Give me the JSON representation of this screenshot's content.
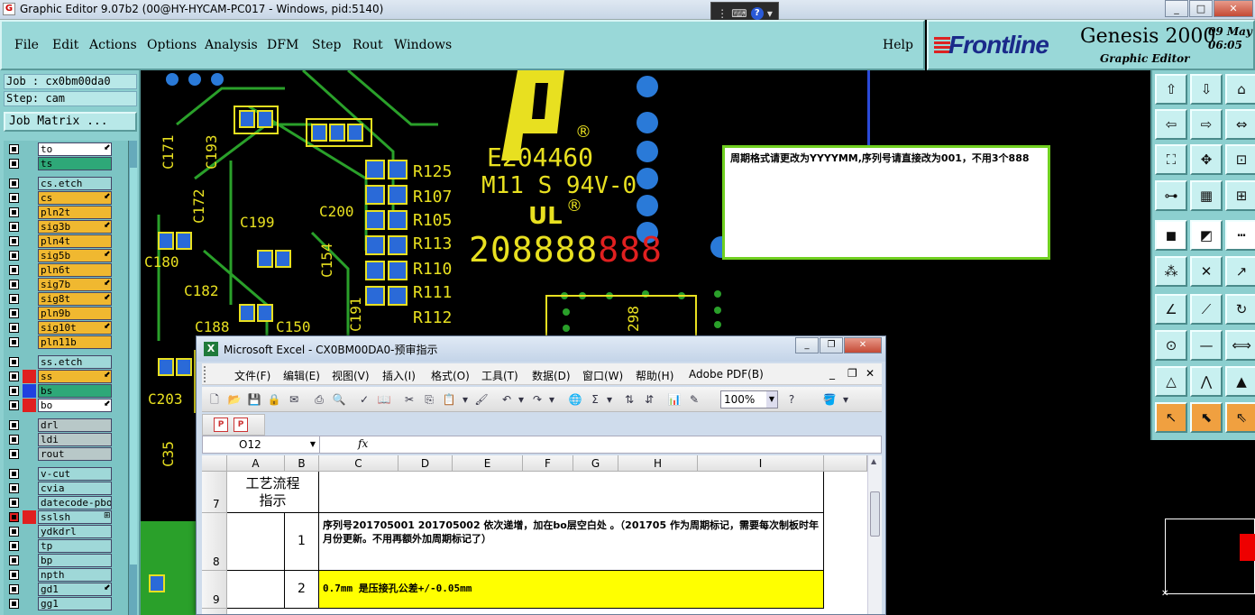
{
  "window": {
    "title": "Graphic Editor 9.07b2 (00@HY-HYCAM-PC017 - Windows, pid:5140)"
  },
  "menu": [
    "File",
    "Edit",
    "Actions",
    "Options",
    "Analysis",
    "DFM",
    "Step",
    "Rout",
    "Windows"
  ],
  "help": "Help",
  "brand": {
    "logo": "Frontline",
    "product": "Genesis 2000",
    "subtitle": "Graphic Editor",
    "date_line1": "09 May",
    "date_line2": "06:05"
  },
  "job": {
    "job_label": "Job : cx0bm00da0",
    "step_label": "Step: cam",
    "matrix_button": "Job Matrix ..."
  },
  "layers": [
    {
      "name": "to",
      "color": "#ffffff",
      "flag": "⬋"
    },
    {
      "name": "ts",
      "color": "#2ea878",
      "flag": ""
    },
    {
      "name": "cs.etch",
      "color": "#9fd8d8",
      "flag": ""
    },
    {
      "name": "cs",
      "color": "#f0b830",
      "flag": "⬋"
    },
    {
      "name": "pln2t",
      "color": "#f0b830",
      "flag": ""
    },
    {
      "name": "sig3b",
      "color": "#f0b830",
      "flag": "⬋"
    },
    {
      "name": "pln4t",
      "color": "#f0b830",
      "flag": ""
    },
    {
      "name": "sig5b",
      "color": "#f0b830",
      "flag": "⬋"
    },
    {
      "name": "pln6t",
      "color": "#f0b830",
      "flag": ""
    },
    {
      "name": "sig7b",
      "color": "#f0b830",
      "flag": "⬋"
    },
    {
      "name": "sig8t",
      "color": "#f0b830",
      "flag": "⬋"
    },
    {
      "name": "pln9b",
      "color": "#f0b830",
      "flag": ""
    },
    {
      "name": "sig10t",
      "color": "#f0b830",
      "flag": "⬋"
    },
    {
      "name": "pln11b",
      "color": "#f0b830",
      "flag": ""
    },
    {
      "name": "ss.etch",
      "color": "#9fd8d8",
      "flag": ""
    },
    {
      "name": "ss",
      "color": "#f0b830",
      "flag": "⬋"
    },
    {
      "name": "bs",
      "color": "#2ea878",
      "flag": ""
    },
    {
      "name": "bo",
      "color": "#ffffff",
      "flag": "⬋"
    },
    {
      "name": "drl",
      "color": "#b8c8c8",
      "flag": ""
    },
    {
      "name": "ldi",
      "color": "#b8c8c8",
      "flag": ""
    },
    {
      "name": "rout",
      "color": "#b8c8c8",
      "flag": ""
    },
    {
      "name": "v-cut",
      "color": "#9fd8d8",
      "flag": ""
    },
    {
      "name": "cvia",
      "color": "#9fd8d8",
      "flag": ""
    },
    {
      "name": "datecode-pbo",
      "color": "#9fd8d8",
      "flag": ""
    },
    {
      "name": "sslsh",
      "color": "#9fd8d8",
      "flag": "⊞"
    },
    {
      "name": "ydkdrl",
      "color": "#9fd8d8",
      "flag": ""
    },
    {
      "name": "tp",
      "color": "#9fd8d8",
      "flag": ""
    },
    {
      "name": "bp",
      "color": "#9fd8d8",
      "flag": ""
    },
    {
      "name": "npth",
      "color": "#9fd8d8",
      "flag": ""
    },
    {
      "name": "gd1",
      "color": "#9fd8d8",
      "flag": "⬋"
    },
    {
      "name": "gg1",
      "color": "#9fd8d8",
      "flag": ""
    }
  ],
  "canvas": {
    "marking_lines": [
      "E204460",
      "M11 S 94V-0"
    ],
    "serial_white": "208888",
    "serial_red": "888",
    "ul_mark": "®",
    "refs_right": [
      "R125",
      "R107",
      "R105",
      "R113",
      "R110",
      "R111",
      "R112"
    ],
    "refs_misc": [
      "C171",
      "C193",
      "C199",
      "C180",
      "C182",
      "C150",
      "C154",
      "C172",
      "C191",
      "C203",
      "C35",
      "C200",
      "C188",
      "298"
    ]
  },
  "note": {
    "text": "周期格式请更改为YYYYMM,序列号请直接改为001，不用3个888"
  },
  "excel": {
    "title": "Microsoft Excel - CX0BM00DA0-预审指示",
    "menus": [
      "文件(F)",
      "编辑(E)",
      "视图(V)",
      "插入(I)",
      "格式(O)",
      "工具(T)",
      "数据(D)",
      "窗口(W)",
      "帮助(H)",
      "Adobe PDF(B)"
    ],
    "zoom": "100%",
    "namebox": "O12",
    "fx": "fx",
    "columns": [
      "A",
      "B",
      "C",
      "D",
      "E",
      "F",
      "G",
      "H",
      "I"
    ],
    "rows": [
      {
        "num": "7",
        "a": "工艺流程指示",
        "b": "",
        "c": ""
      },
      {
        "num": "8",
        "a": "",
        "b": "1",
        "c": "序列号201705001 201705002 依次递增，加在bo层空白处 。（201705 作为周期标记，需要每次制板时年月份更新。不用再额外加周期标记了）"
      },
      {
        "num": "9",
        "a": "",
        "b": "2",
        "c": "0.7mm 是压接孔公差+/-0.05mm"
      }
    ]
  }
}
